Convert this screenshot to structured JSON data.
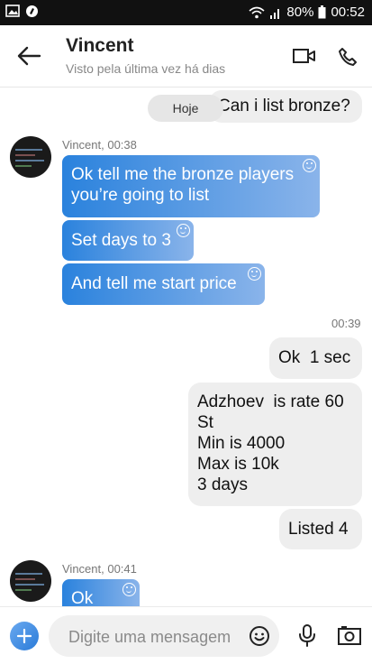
{
  "status_bar": {
    "battery": "80%",
    "time": "00:52"
  },
  "header": {
    "name": "Vincent",
    "subtitle": "Visto pela última vez há dias"
  },
  "chat": {
    "date_chip": "Hoje",
    "messages": [
      {
        "text": "Can i list bronze?"
      },
      {
        "sender": "Vincent, 00:38"
      },
      {
        "text_line1": "Ok tell me the bronze players",
        "text_line2": "you’re going to list"
      },
      {
        "text": "Set days to 3"
      },
      {
        "text": "And tell me start price"
      },
      {
        "time": "00:39"
      },
      {
        "text": "Ok  1 sec"
      },
      {
        "lines": [
          "Adzhoev  is rate 60",
          "St",
          "Min is 4000",
          "Max is 10k",
          "3 days"
        ]
      },
      {
        "text": "Listed 4"
      },
      {
        "sender": "Vincent, 00:41"
      },
      {
        "text": "Ok"
      }
    ]
  },
  "composer": {
    "placeholder": "Digite uma mensagem"
  }
}
